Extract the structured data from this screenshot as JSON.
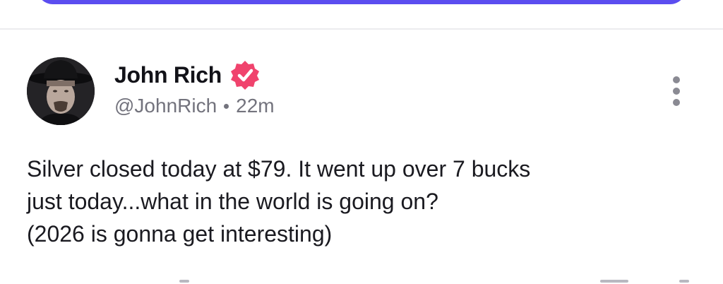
{
  "post": {
    "author": {
      "display_name": "John Rich",
      "handle": "@JohnRich",
      "verified": true,
      "verified_badge_color": "#f0436d"
    },
    "time_ago": "22m",
    "body_lines": [
      "Silver closed today at $79. It went up over 7 bucks",
      "just today...what in the world is going on?",
      "(2026 is gonna get interesting)"
    ]
  },
  "colors": {
    "accent_button": "#5b4df0",
    "text_primary": "#121218",
    "text_secondary": "#73737d"
  },
  "icons": {
    "verified": "verified-badge-icon",
    "more": "more-vertical-icon"
  }
}
